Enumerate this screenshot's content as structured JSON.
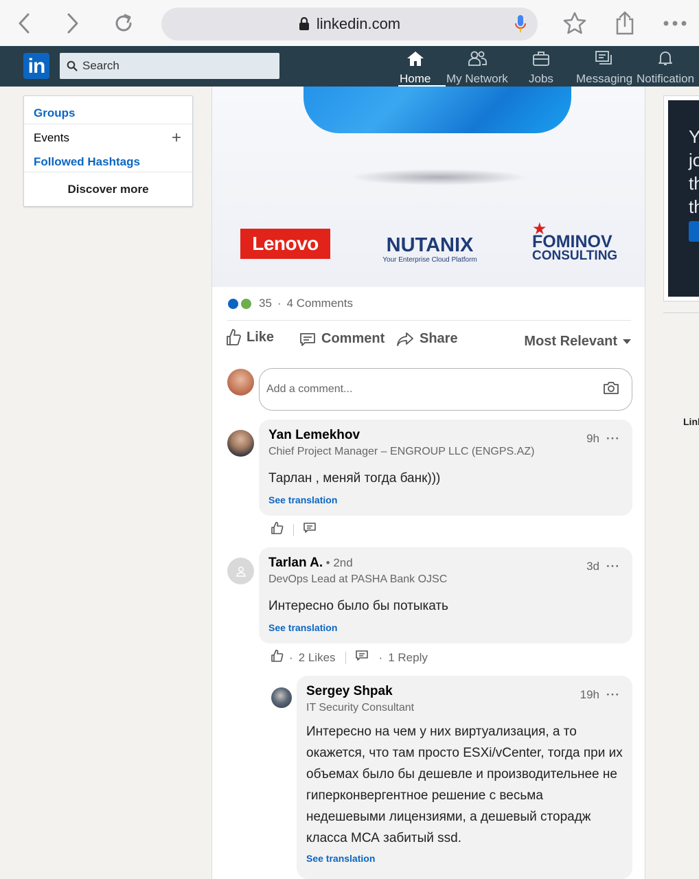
{
  "browser": {
    "url": "linkedin.com",
    "icons": [
      "back-icon",
      "forward-icon",
      "reload-icon",
      "lock-icon",
      "mic-icon",
      "bookmark-star-icon",
      "share-icon",
      "more-icon"
    ]
  },
  "header": {
    "logo_text": "in",
    "search_placeholder": "Search",
    "nav": [
      {
        "label": "Home",
        "icon": "home-icon",
        "active": true
      },
      {
        "label": "My Network",
        "icon": "network-icon"
      },
      {
        "label": "Jobs",
        "icon": "briefcase-icon"
      },
      {
        "label": "Messaging",
        "icon": "messaging-icon"
      },
      {
        "label": "Notification",
        "icon": "bell-icon"
      }
    ]
  },
  "sidebar": {
    "groups": "Groups",
    "events": "Events",
    "hashtags": "Followed Hashtags",
    "discover": "Discover more"
  },
  "post": {
    "brands": {
      "lenovo": "Lenovo",
      "nutanix": "NUTANIX",
      "nutanix_tagline": "Your Enterprise Cloud Platform",
      "fominov_1": "FOMINOV",
      "fominov_2": "CONSULTING"
    },
    "reactions_count": "35",
    "dot": "·",
    "comments_count": "4 Comments",
    "actions": {
      "like": "Like",
      "comment": "Comment",
      "share": "Share"
    },
    "sort": "Most Relevant",
    "comment_placeholder": "Add a comment..."
  },
  "comments": [
    {
      "name": "Yan Lemekhov",
      "headline": "Chief Project Manager – ENGROUP LLC (ENGPS.AZ)",
      "time": "9h",
      "more": "···",
      "text": "Тарлан , меняй тогда банк)))",
      "translate": "See translation"
    },
    {
      "name": "Tarlan A.",
      "degree": "• 2nd",
      "headline": "DevOps Lead at PASHA Bank OJSC",
      "time": "3d",
      "more": "···",
      "text": "Интересно было бы потыкать",
      "translate": "See translation",
      "dot": "·",
      "likes": "2 Likes",
      "replies": "1 Reply"
    },
    {
      "name": "Sergey Shpak",
      "headline": "IT Security Consultant",
      "time": "19h",
      "more": "···",
      "text": "Интересно на чем у них виртуализация, а то окажется, что там просто ESXi/vCenter, тогда при их объемах было бы дешевле и производительнее не гиперконвергентное решение с весьма недешевыми лицензиями, а дешевый сторадж класса МСА забитый ssd.",
      "translate": "See translation"
    }
  ],
  "right_rail": {
    "ad_lines": [
      "Yo",
      "jo",
      "th",
      "th"
    ],
    "text": "Link"
  },
  "colors": {
    "linkedin_blue": "#0a66c2",
    "header_bg": "#283e4a",
    "lenovo_red": "#e2231a"
  }
}
